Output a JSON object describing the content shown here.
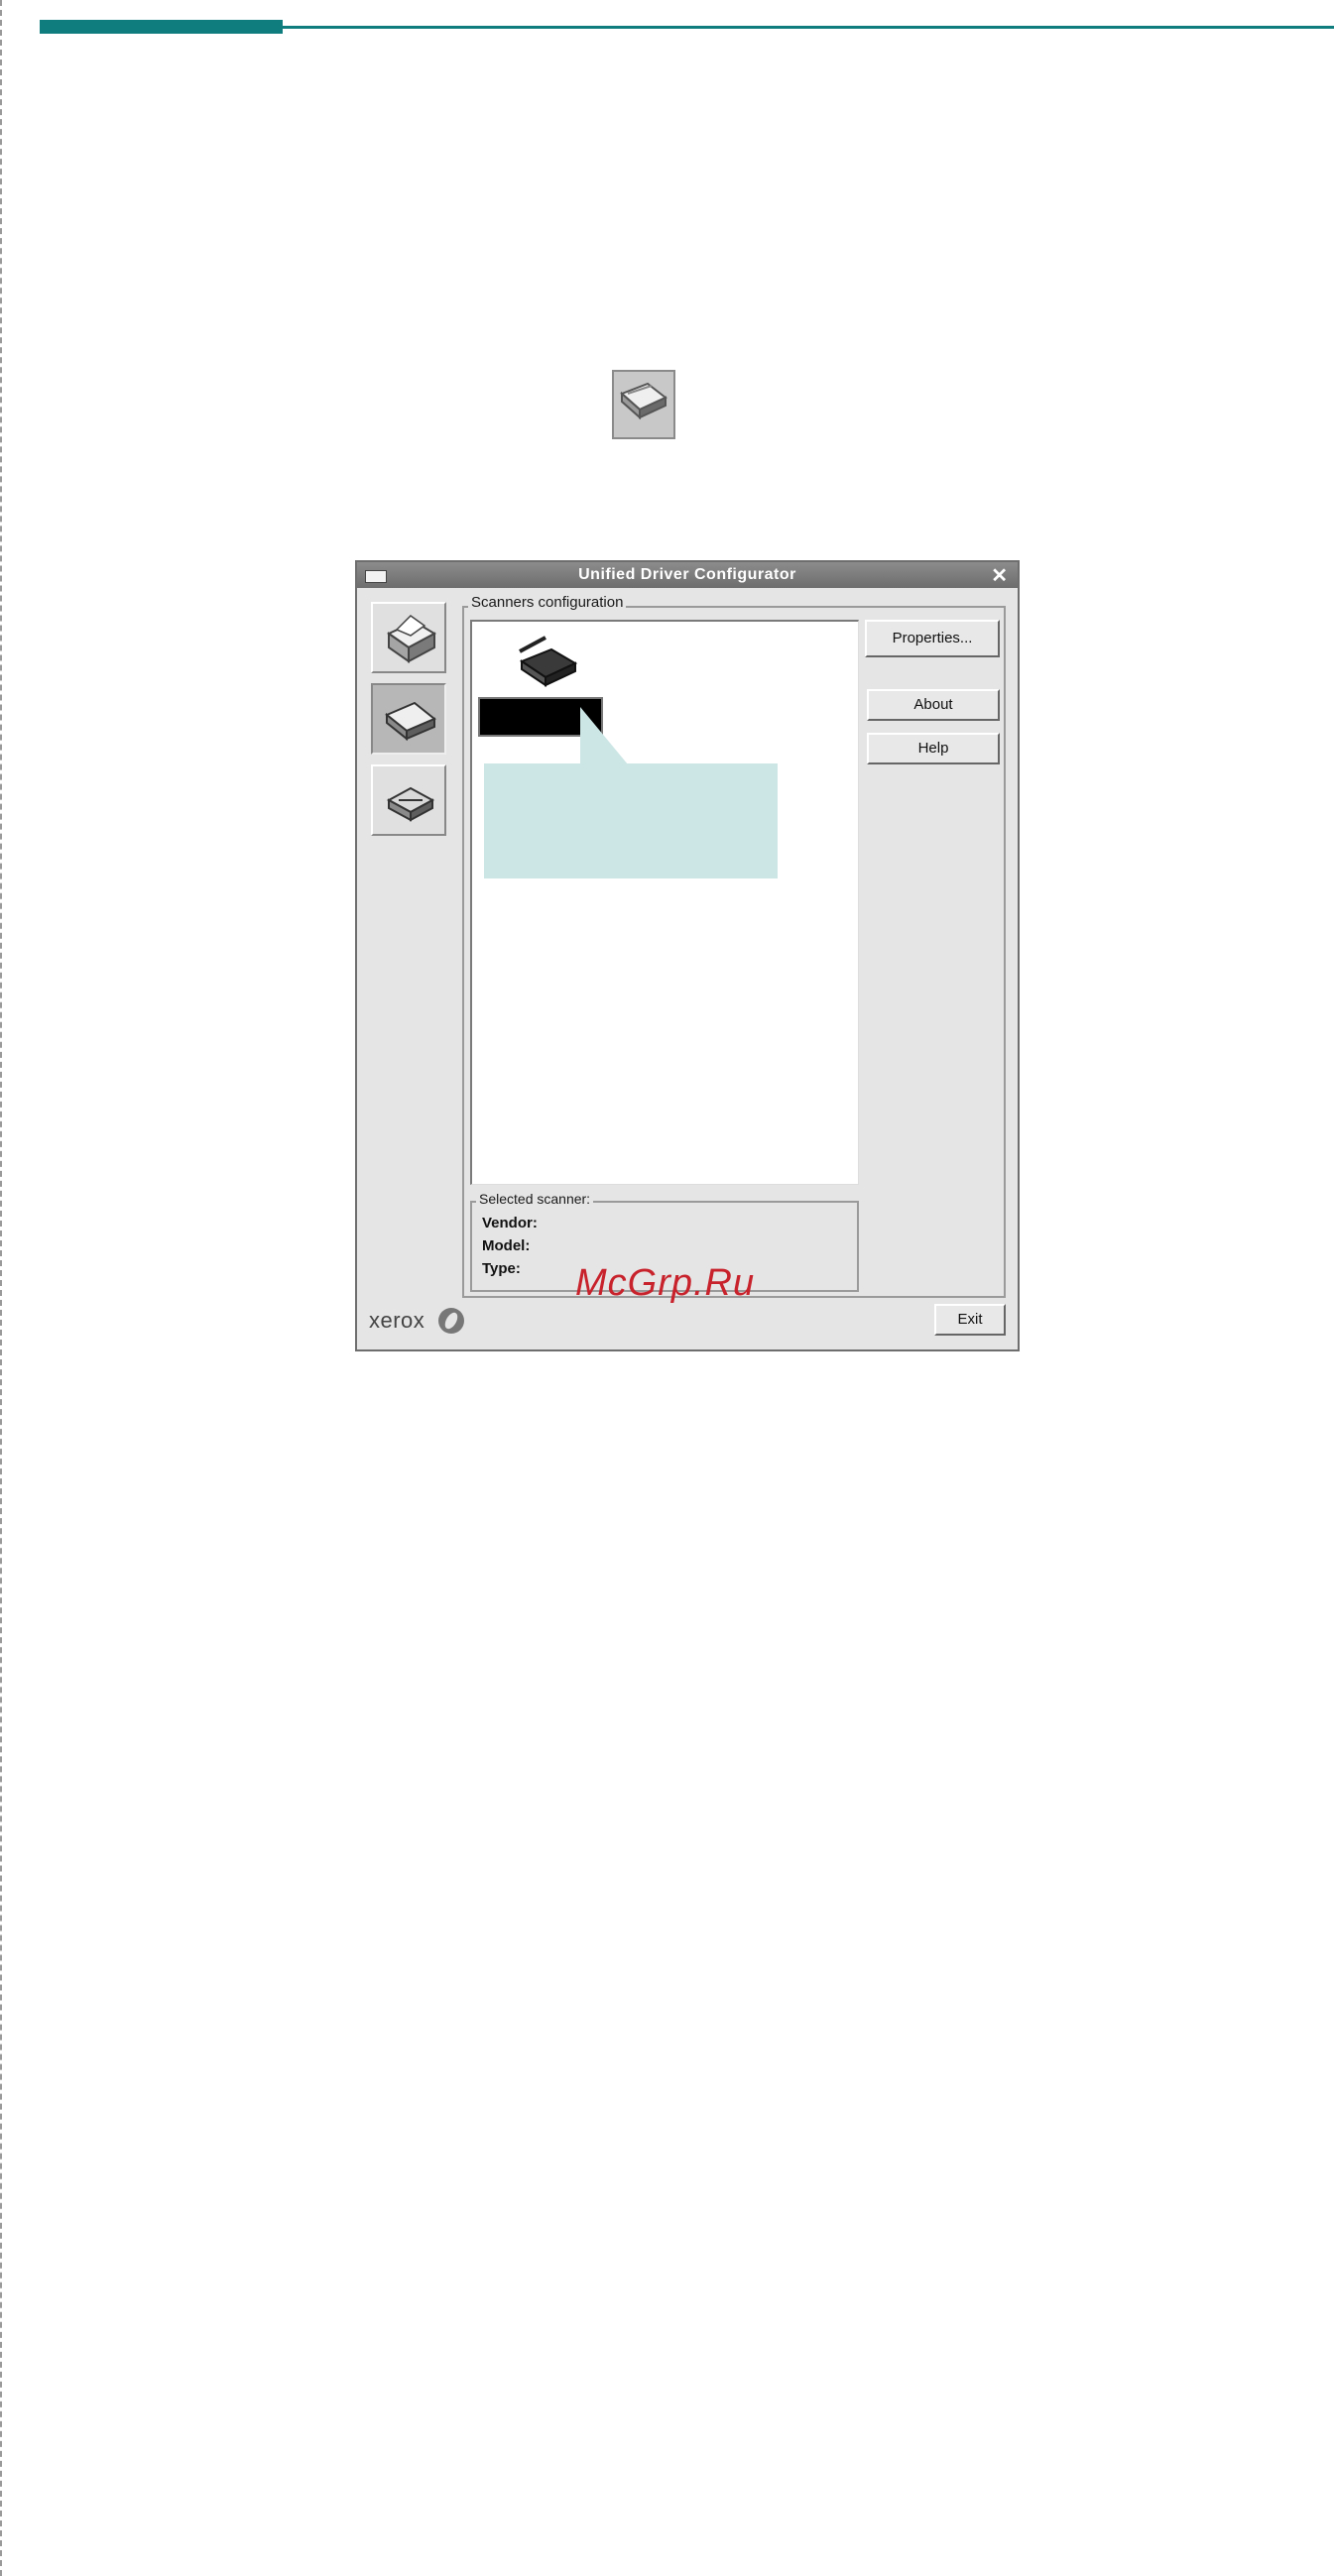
{
  "window": {
    "title": "Unified Driver Configurator",
    "close_glyph": "✕"
  },
  "sidebar": {
    "items": [
      {
        "icon": "printer-icon",
        "active": false
      },
      {
        "icon": "scanner-icon",
        "active": true
      },
      {
        "icon": "port-icon",
        "active": false
      }
    ]
  },
  "scanners_group": {
    "label": "Scanners configuration"
  },
  "buttons": {
    "properties": "Properties...",
    "about": "About",
    "help": "Help",
    "exit": "Exit"
  },
  "selected_scanner": {
    "label": "Selected scanner:",
    "vendor_label": "Vendor:",
    "model_label": "Model:",
    "type_label": "Type:"
  },
  "logo": {
    "text": "xerox"
  },
  "watermark": {
    "text": "McGrp.Ru"
  },
  "colors": {
    "accent": "#0f7d7d",
    "callout": "#cce5e5",
    "watermark": "#c8232c"
  }
}
